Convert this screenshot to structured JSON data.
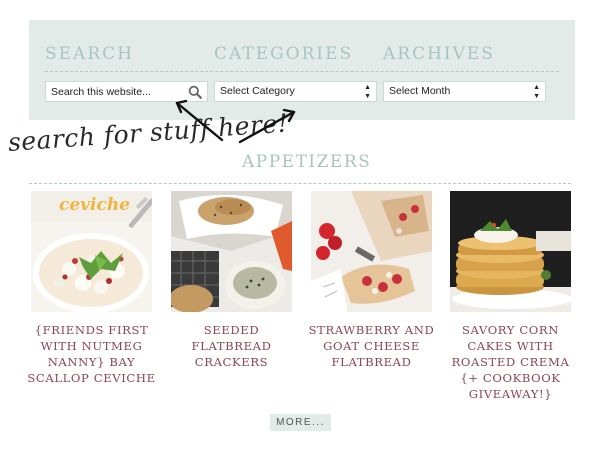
{
  "widgets": {
    "search_title": "SEARCH",
    "categories_title": "CATEGORIES",
    "archives_title": "ARCHIVES",
    "search_placeholder": "Search this website...",
    "category_selected": "Select Category",
    "month_selected": "Select Month"
  },
  "annotation": {
    "text": "search for stuff here!"
  },
  "section": {
    "title": "APPETIZERS"
  },
  "posts": [
    {
      "title": "{FRIENDS FIRST WITH NUTMEG NANNY} BAY SCALLOP CEVICHE",
      "image_text": "ceviche"
    },
    {
      "title": "SEEDED FLATBREAD CRACKERS"
    },
    {
      "title": "STRAWBERRY AND GOAT CHEESE FLATBREAD"
    },
    {
      "title": "SAVORY CORN CAKES WITH ROASTED CREMA {+ COOKBOOK GIVEAWAY!}"
    }
  ],
  "more_button": "MORE..."
}
